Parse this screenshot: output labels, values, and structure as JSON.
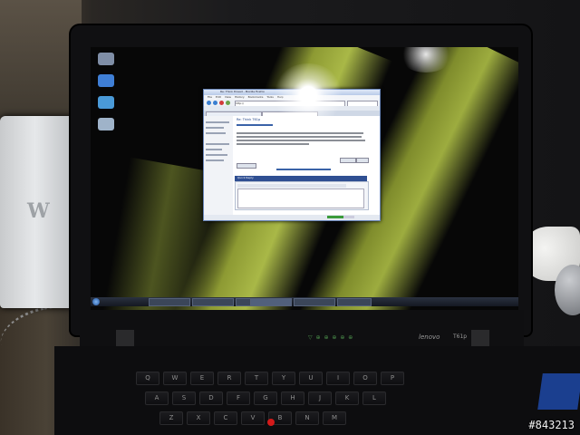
{
  "browser": {
    "title": "Re: Think thread - Mozilla Firefox",
    "menu": [
      "File",
      "Edit",
      "View",
      "History",
      "Bookmarks",
      "Tools",
      "Help"
    ],
    "url": "http://",
    "bookmarks": "",
    "tabs": [
      "",
      ""
    ],
    "post_title": "Re: Think T61p",
    "quick_reply": "Quick Reply",
    "progress": 0.6
  },
  "laptop": {
    "brand": "lenovo",
    "model": "T61p",
    "leds": "▽ ⊕ ⊕ ⊕ ⊕ ⊕"
  },
  "keyboard": {
    "rows": [
      [
        "Q",
        "W",
        "E",
        "R",
        "T",
        "Y",
        "U",
        "I",
        "O",
        "P"
      ],
      [
        "A",
        "S",
        "D",
        "F",
        "G",
        "H",
        "J",
        "K",
        "L"
      ],
      [
        "Z",
        "X",
        "C",
        "V",
        "B",
        "N",
        "M"
      ]
    ]
  },
  "watermark": "#843213"
}
